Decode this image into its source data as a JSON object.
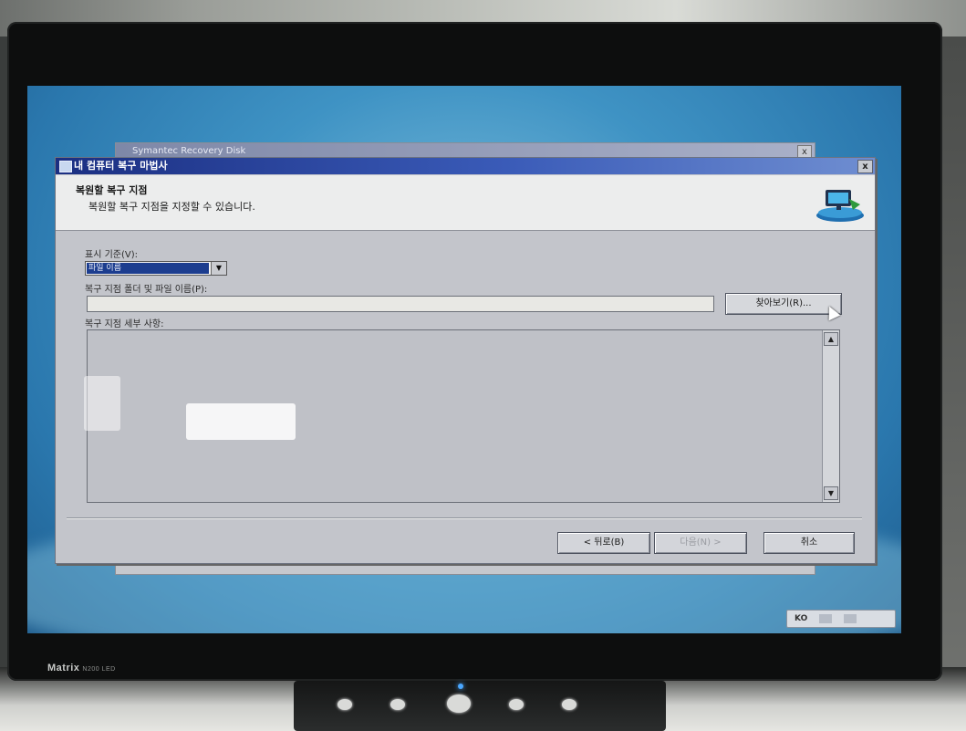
{
  "background_window": {
    "title": "Symantec Recovery Disk",
    "close_label": "x"
  },
  "wizard": {
    "title": "내 컴퓨터 복구 마법사",
    "close_label": "x",
    "header_title": "복원할 복구 지점",
    "header_subtitle": "복원할 복구 지점을 지정할 수 있습니다.",
    "view_by_label": "표시 기준(V):",
    "view_by_value": "파일 이름",
    "path_label": "복구 지점 폴더 및 파일 이름(P):",
    "path_value": "",
    "browse_label": "찾아보기(R)...",
    "details_label": "복구 지점 세부 사항:",
    "back_label": "< 뒤로(B)",
    "next_label": "다음(N) >",
    "cancel_label": "취소"
  },
  "taskbar": {
    "language": "KO"
  },
  "monitor": {
    "brand": "Matrix",
    "model": "N200 LED"
  }
}
